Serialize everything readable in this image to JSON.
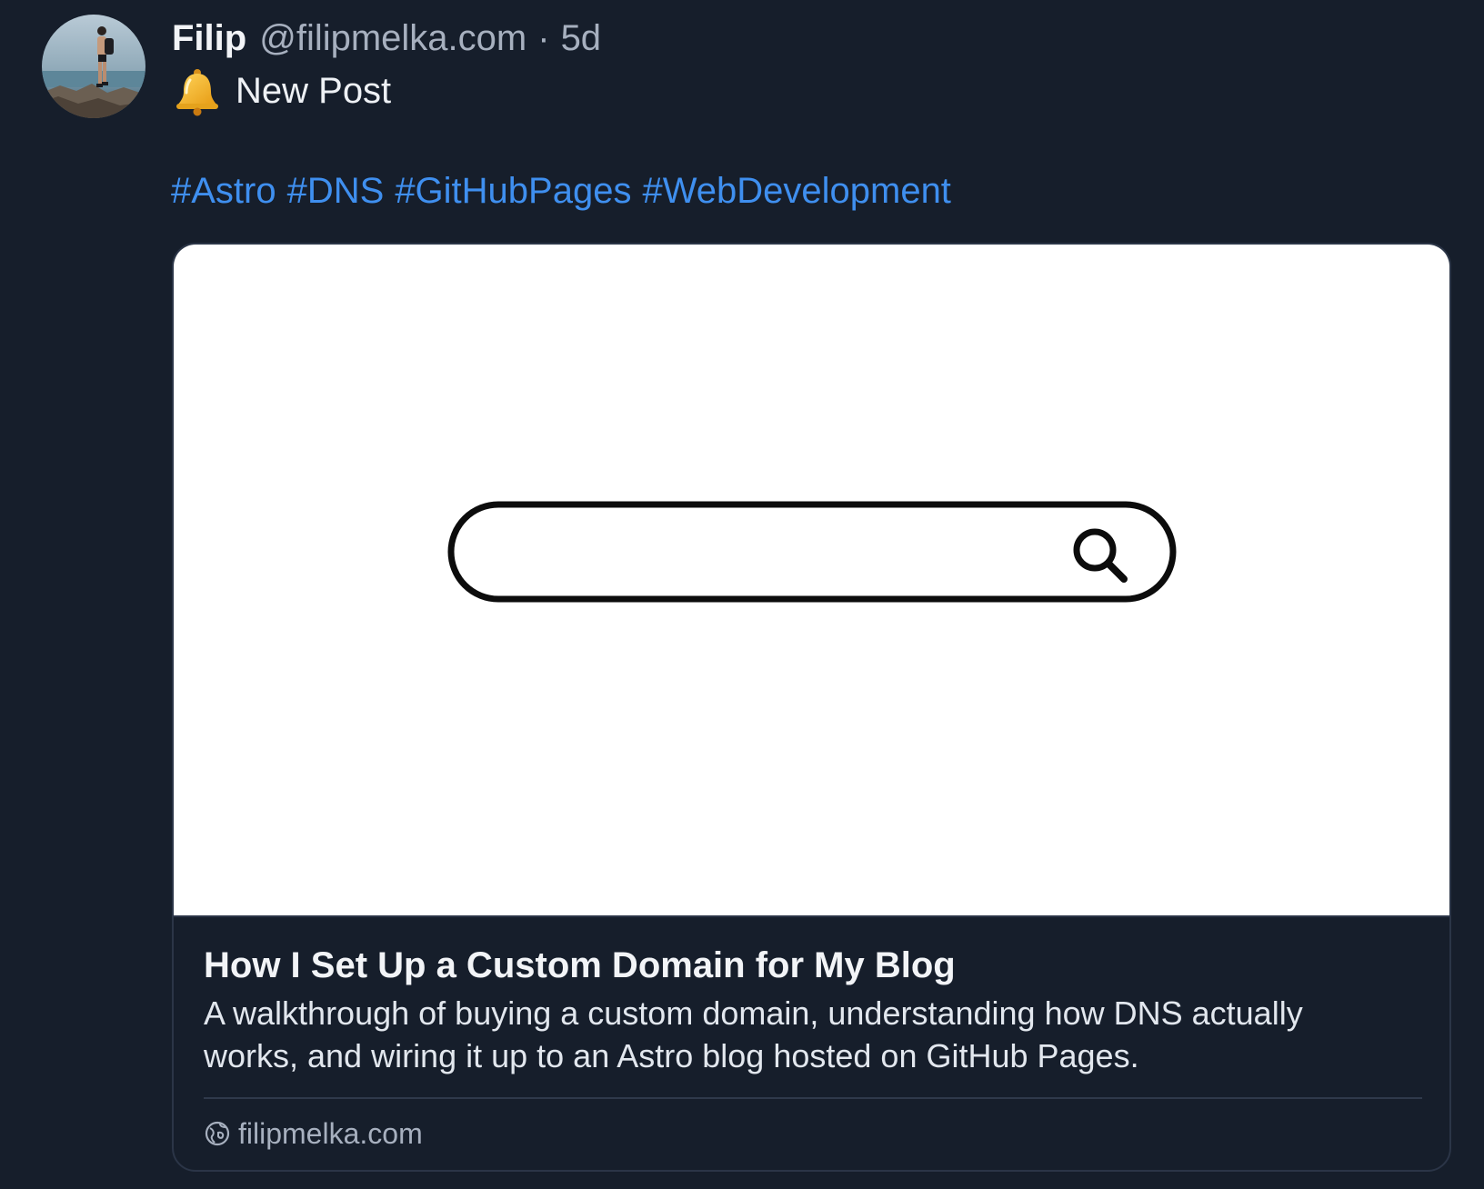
{
  "post": {
    "author_name": "Filip",
    "author_handle": "@filipmelka.com",
    "separator": "·",
    "timestamp": "5d",
    "avatar_icon": "avatar-photo-hiker",
    "bell_icon": "bell-icon",
    "text": "New Post",
    "hashtags": [
      "#Astro",
      "#DNS",
      "#GitHubPages",
      "#WebDevelopment"
    ]
  },
  "link_card": {
    "image_icon": "search-bar-illustration",
    "title": "How I Set Up a Custom Domain for My Blog",
    "description": "A walkthrough of buying a custom domain, understanding how DNS actually works, and wiring it up to an Astro blog hosted on GitHub Pages.",
    "domain": "filipmelka.com",
    "domain_icon": "globe-icon"
  },
  "colors": {
    "background": "#161e2b",
    "hashtag": "#3f8fef",
    "muted_text": "#a7b0bf",
    "card_border": "#2b3547"
  }
}
